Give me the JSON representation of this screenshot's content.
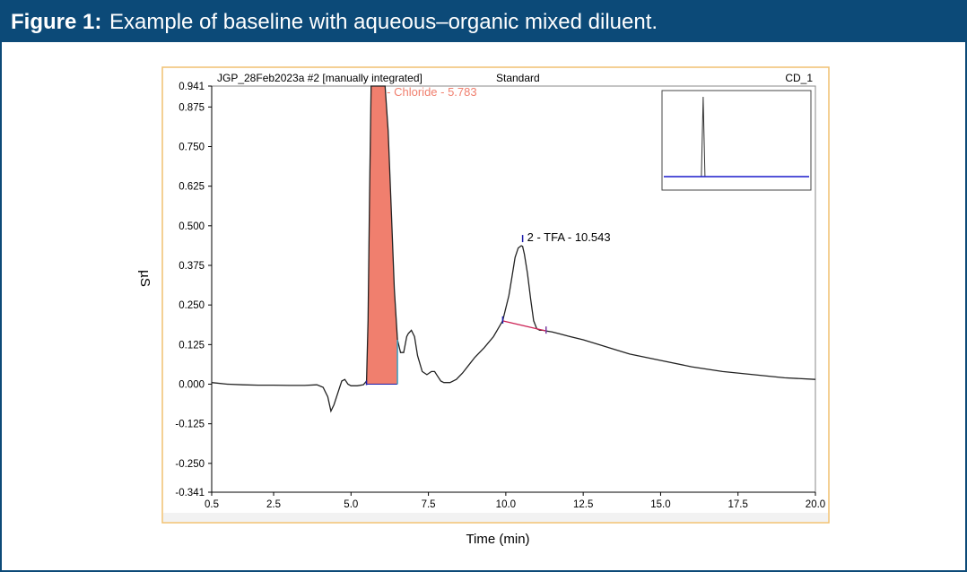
{
  "figure": {
    "label": "Figure 1:",
    "caption": "Example of baseline with aqueous–organic mixed diluent."
  },
  "chart_data": {
    "type": "line",
    "header": {
      "sample": "JGP_28Feb2023a #2 [manually integrated]",
      "mode": "Standard",
      "channel": "CD_1"
    },
    "xlabel": "Time (min)",
    "ylabel": "µS",
    "xlim": [
      0.5,
      20.0
    ],
    "ylim": [
      -0.341,
      0.941
    ],
    "x_ticks": [
      "0.5",
      "2.5",
      "5.0",
      "7.5",
      "10.0",
      "12.5",
      "15.0",
      "17.5",
      "20.0"
    ],
    "y_ticks": [
      "0.941",
      "0.875",
      "0.750",
      "0.625",
      "0.500",
      "0.375",
      "0.250",
      "0.125",
      "0.000",
      "-0.125",
      "-0.250",
      "-0.341"
    ],
    "series": [
      {
        "x": [
          0.5,
          1.0,
          1.5,
          2.0,
          2.5,
          3.0,
          3.5,
          3.9,
          4.1,
          4.25,
          4.35,
          4.45,
          4.6,
          4.7,
          4.8,
          4.9,
          5.0,
          5.2,
          5.4,
          5.5,
          5.55,
          5.6,
          5.65,
          5.7,
          5.783,
          5.9,
          6.0,
          6.1,
          6.2,
          6.3,
          6.4,
          6.5,
          6.6,
          6.7,
          6.8,
          6.85,
          6.95,
          7.05,
          7.15,
          7.3,
          7.45,
          7.6,
          7.7,
          7.8,
          7.9,
          8.0,
          8.2,
          8.4,
          8.6,
          8.8,
          9.0,
          9.3,
          9.6,
          9.9,
          10.1,
          10.2,
          10.3,
          10.4,
          10.5,
          10.543,
          10.6,
          10.7,
          10.8,
          10.9,
          11.0,
          11.1,
          11.2,
          11.3,
          11.5,
          11.7,
          12.0,
          12.5,
          13.0,
          13.5,
          14.0,
          15.0,
          16.0,
          17.0,
          18.0,
          19.0,
          20.0
        ],
        "y": [
          0.005,
          0.0,
          -0.002,
          -0.003,
          -0.003,
          -0.004,
          -0.004,
          -0.002,
          -0.01,
          -0.04,
          -0.085,
          -0.065,
          -0.02,
          0.01,
          0.015,
          0.0,
          -0.005,
          -0.005,
          -0.002,
          0.01,
          0.2,
          0.6,
          0.941,
          0.941,
          0.941,
          0.941,
          0.941,
          0.941,
          0.8,
          0.55,
          0.3,
          0.14,
          0.1,
          0.1,
          0.15,
          0.16,
          0.17,
          0.15,
          0.09,
          0.04,
          0.03,
          0.04,
          0.04,
          0.025,
          0.01,
          0.005,
          0.005,
          0.015,
          0.035,
          0.06,
          0.085,
          0.115,
          0.15,
          0.2,
          0.28,
          0.34,
          0.4,
          0.43,
          0.437,
          0.435,
          0.41,
          0.35,
          0.27,
          0.2,
          0.175,
          0.17,
          0.17,
          0.168,
          0.165,
          0.16,
          0.152,
          0.14,
          0.125,
          0.11,
          0.095,
          0.075,
          0.055,
          0.04,
          0.03,
          0.02,
          0.015
        ]
      }
    ],
    "peaks": [
      {
        "label": "1 - Chloride - 5.783",
        "x": 5.783,
        "start": 5.5,
        "end": 6.5,
        "color": "#f07f6e"
      },
      {
        "label": "2 - TFA - 10.543",
        "x": 10.543,
        "start": 9.9,
        "end": 11.3,
        "color": "#cc2255"
      }
    ],
    "colors": {
      "trace": "#222222",
      "baseline_marker": "#1a1aa8",
      "inset_baseline": "#1a1acc",
      "frame": "#f0c070"
    }
  }
}
